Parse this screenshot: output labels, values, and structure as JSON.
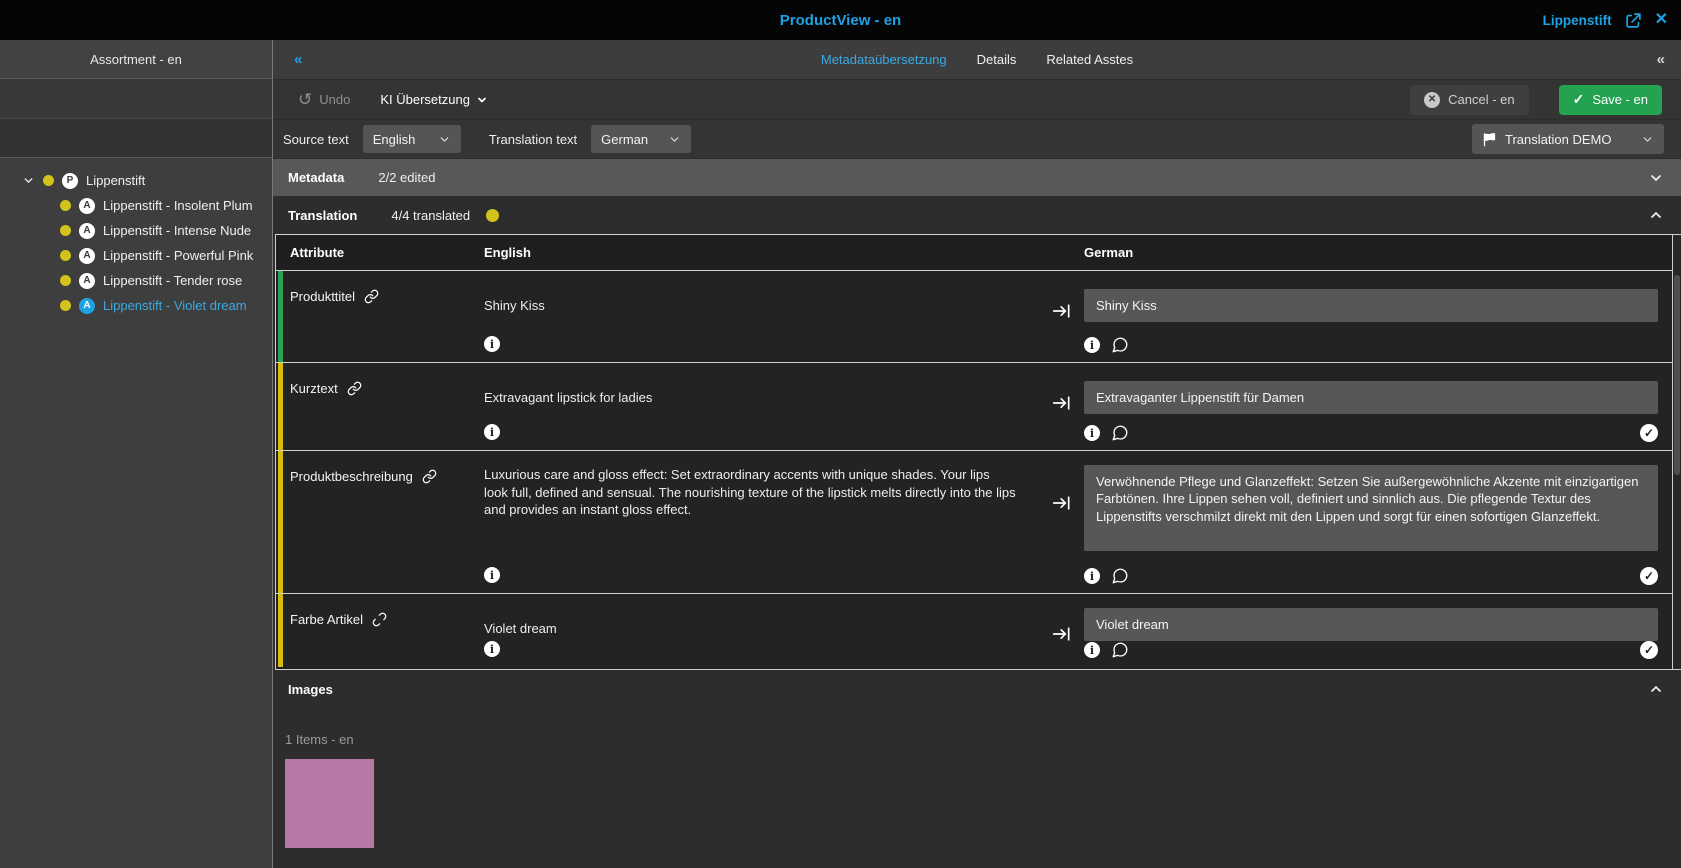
{
  "titlebar": {
    "title": "ProductView - en",
    "entity": "Lippenstift"
  },
  "nav": {
    "collapse_glyph": "«"
  },
  "tabs": [
    {
      "label": "Metadataübersetzung",
      "active": true
    },
    {
      "label": "Details",
      "active": false
    },
    {
      "label": "Related Asstes",
      "active": false
    }
  ],
  "sidebar": {
    "header": "Assortment - en",
    "root": {
      "label": "Lippenstift",
      "badge": "P"
    },
    "items": [
      {
        "label": "Lippenstift - Insolent Plum",
        "badge": "A",
        "selected": false
      },
      {
        "label": "Lippenstift - Intense Nude",
        "badge": "A",
        "selected": false
      },
      {
        "label": "Lippenstift - Powerful Pink",
        "badge": "A",
        "selected": false
      },
      {
        "label": "Lippenstift - Tender rose",
        "badge": "A",
        "selected": false
      },
      {
        "label": "Lippenstift - Violet dream",
        "badge": "A",
        "selected": true
      }
    ]
  },
  "toolbar": {
    "undo_label": "Undo",
    "undo_glyph": "↺",
    "ai_menu_label": "KI Übersetzung",
    "cancel_label": "Cancel - en",
    "save_label": "Save - en"
  },
  "langbar": {
    "source_label": "Source text",
    "source_value": "English",
    "target_label": "Translation text",
    "target_value": "German",
    "profile_value": "Translation DEMO"
  },
  "sections": {
    "metadata": {
      "title": "Metadata",
      "status": "2/2 edited"
    },
    "translation": {
      "title": "Translation",
      "status": "4/4 translated"
    },
    "images": {
      "title": "Images",
      "items_label": "1 Items - en"
    }
  },
  "table": {
    "headers": {
      "attribute": "Attribute",
      "english": "English",
      "german": "German"
    },
    "rows": [
      {
        "attribute": "Produkttitel",
        "linked": true,
        "accent": "green",
        "english": "Shiny Kiss",
        "german": "Shiny Kiss",
        "translated": false
      },
      {
        "attribute": "Kurztext",
        "linked": true,
        "accent": "yellow",
        "english": "Extravagant lipstick for ladies",
        "german": "Extravaganter Lippenstift für Damen",
        "translated": true
      },
      {
        "attribute": "Produktbeschreibung",
        "linked": true,
        "accent": "yellow",
        "english": "Luxurious care and gloss effect: Set extraordinary accents with unique shades. Your lips look full, defined and sensual. The nourishing texture of the lipstick melts directly into the lips and provides an instant gloss effect.",
        "german": "Verwöhnende Pflege und Glanzeffekt: Setzen Sie außergewöhnliche Akzente mit einzigartigen Farbtönen. Ihre Lippen sehen voll, definiert und sinnlich aus. Die pflegende Textur des Lippenstifts verschmilzt direkt mit den Lippen und sorgt für einen sofortigen Glanzeffekt.",
        "translated": true
      },
      {
        "attribute": "Farbe Artikel",
        "linked": false,
        "accent": "yellow",
        "english": "Violet dream",
        "german": "Violet dream",
        "translated": true
      }
    ]
  },
  "icons": {
    "info_glyph": "i",
    "check_glyph": "✓",
    "cancel_x_glyph": "✕",
    "close_glyph": "✕"
  },
  "colors": {
    "accent_cyan": "#1ea2e4",
    "save_green": "#23a24f",
    "status_yellow": "#d2c31c",
    "row_green": "#2ba155",
    "row_yellow": "#d9ba0f",
    "image_pink": "#b678a6"
  }
}
